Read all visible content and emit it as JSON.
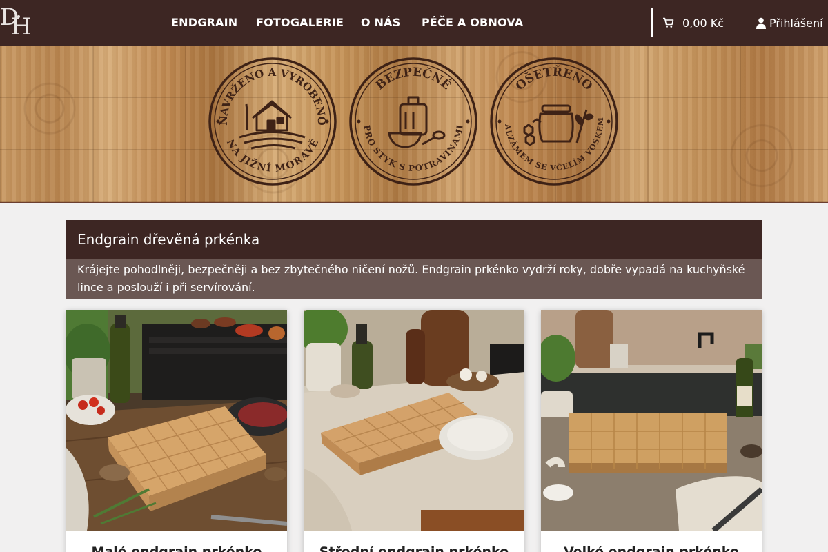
{
  "brand": {
    "logo_letters": [
      "D",
      "H"
    ]
  },
  "nav": {
    "items": [
      "ENDGRAIN",
      "FOTOGALERIE",
      "O NÁS",
      "PÉČE A OBNOVA"
    ]
  },
  "cart": {
    "total": "0,00 Kč",
    "icon": "cart-icon"
  },
  "login": {
    "label": "Přihlášení",
    "icon": "user-icon"
  },
  "banner": {
    "badges": [
      {
        "top_text": "NAVRŽENO A VYROBENO",
        "bottom_text": "NA JIŽNÍ MORAVĚ",
        "icon": "house-field-icon"
      },
      {
        "top_text": "BEZPEČNÉ",
        "bottom_text": "PRO STYK S POTRAVINAMI",
        "icon": "board-bowl-spoon-icon"
      },
      {
        "top_text": "OŠETŘENO",
        "bottom_text": "BALZÁMEM SE VČELÍM VOSKEM",
        "icon": "honey-jar-icon"
      }
    ]
  },
  "intro": {
    "title": "Endgrain dřevěná prkénka",
    "text": "Krájejte pohodlněji, bezpečněji a bez zbytečného ničení nožů. Endgrain prkénko vydrží roky, dobře vypadá na kuchyňské lince a poslouží i při servírování."
  },
  "products": [
    {
      "title": "Malé endgrain prkénko"
    },
    {
      "title": "Střední endgrain prkénko"
    },
    {
      "title": "Velké endgrain prkénko"
    }
  ],
  "colors": {
    "header": "#3d2623",
    "intro_text_bg": "#6a5753",
    "page_bg": "#f1f0f0",
    "badge_ink": "#3e2216"
  }
}
